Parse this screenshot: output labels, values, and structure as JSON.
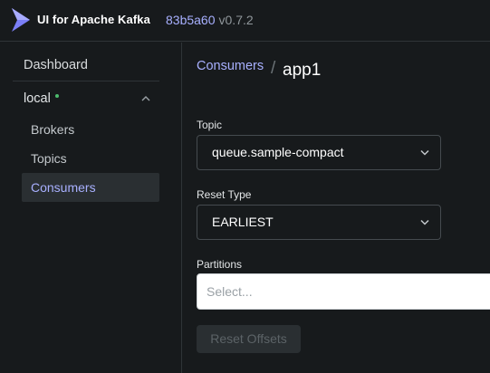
{
  "header": {
    "brand": "UI for Apache Kafka",
    "commit": "83b5a60",
    "version": "v0.7.2"
  },
  "sidebar": {
    "dashboard_label": "Dashboard",
    "cluster_name": "local",
    "items": [
      {
        "label": "Brokers",
        "active": false
      },
      {
        "label": "Topics",
        "active": false
      },
      {
        "label": "Consumers",
        "active": true
      }
    ]
  },
  "breadcrumb": {
    "parent": "Consumers",
    "separator": "/",
    "current": "app1"
  },
  "form": {
    "topic_label": "Topic",
    "topic_value": "queue.sample-compact",
    "reset_type_label": "Reset Type",
    "reset_type_value": "EARLIEST",
    "partitions_label": "Partitions",
    "partitions_placeholder": "Select...",
    "reset_button_label": "Reset Offsets",
    "reset_button_disabled": true
  },
  "colors": {
    "accent": "#a8b0ff",
    "background": "#171a1c",
    "status_online": "#4cbb6c"
  },
  "icons": {
    "logo": "kafka-ui-logo-icon",
    "cluster_toggle": "chevron-up-icon",
    "select_arrow": "chevron-down-icon"
  }
}
